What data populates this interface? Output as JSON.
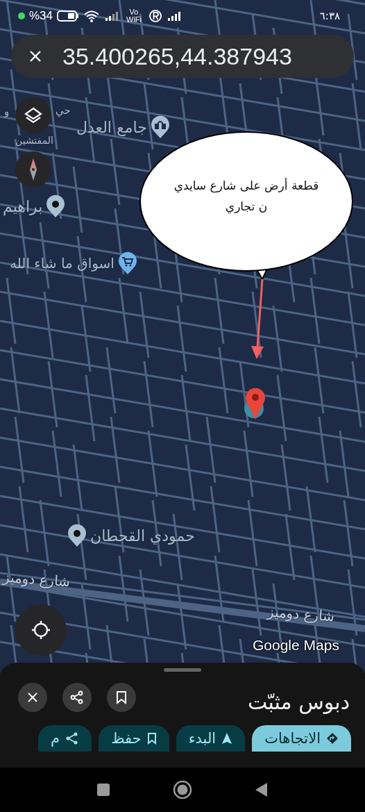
{
  "status_bar": {
    "battery_percent": "%34",
    "wifi_calling": "Vo WiFi",
    "clock": "٦:٣٨"
  },
  "search": {
    "value": "35.400265,44.387943"
  },
  "map": {
    "labels": [
      {
        "text": "جامع العدل",
        "kind": "mosque"
      },
      {
        "text": "حي",
        "kind": "area"
      },
      {
        "text": "و",
        "kind": "area"
      },
      {
        "text": "المفتشين",
        "kind": "area"
      },
      {
        "text": "براهيم",
        "kind": "place"
      },
      {
        "text": "اسواق ما شاء الله",
        "kind": "shop"
      },
      {
        "text": "حمودي القحطان",
        "kind": "place"
      },
      {
        "text": "شارع دوميز",
        "kind": "street"
      },
      {
        "text": "شارع دوميز",
        "kind": "street"
      }
    ],
    "annotation": {
      "lines": [
        "قطعة أرض على شارع سايدي",
        "ن تجاري"
      ]
    },
    "attribution": "Google Maps"
  },
  "sheet": {
    "title": "دبوس مثبّت",
    "actions": [
      {
        "kind": "directions",
        "label": "الاتجاهات"
      },
      {
        "kind": "start",
        "label": "البدء"
      },
      {
        "kind": "save",
        "label": "حفظ"
      },
      {
        "kind": "share",
        "label": "م"
      }
    ]
  }
}
